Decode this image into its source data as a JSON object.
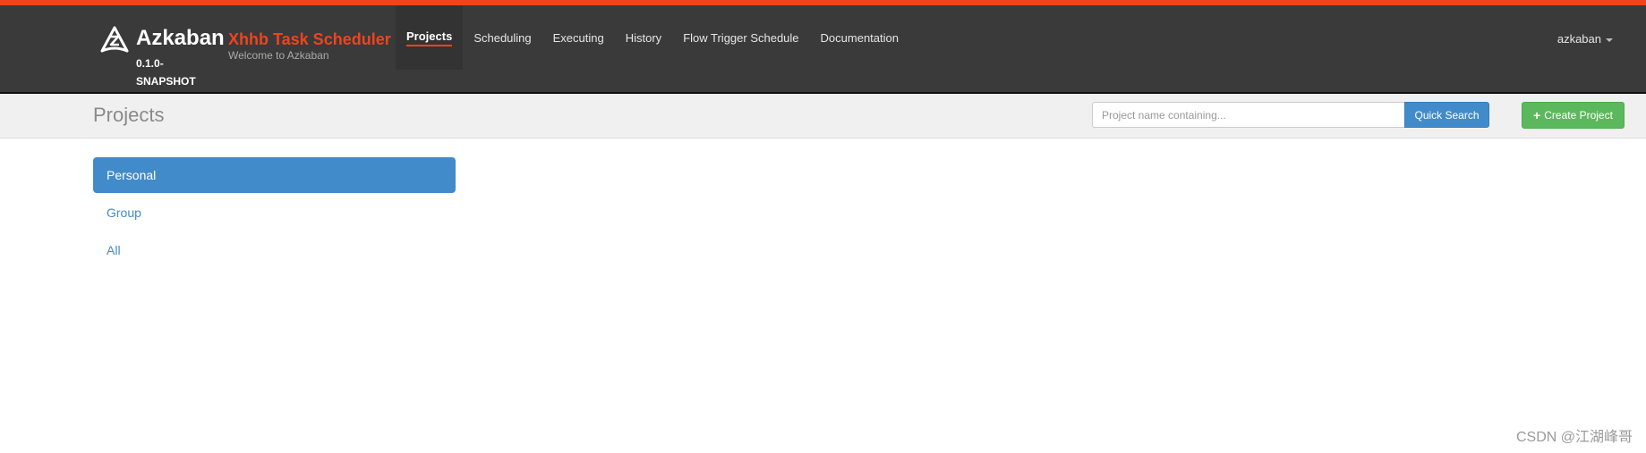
{
  "brand": {
    "name": "Azkaban",
    "version": "0.1.0-SNAPSHOT",
    "scheduler_title": "Xhhb Task Scheduler",
    "welcome": "Welcome to Azkaban"
  },
  "nav": {
    "items": [
      {
        "label": "Projects",
        "active": true
      },
      {
        "label": "Scheduling"
      },
      {
        "label": "Executing"
      },
      {
        "label": "History"
      },
      {
        "label": "Flow Trigger Schedule"
      },
      {
        "label": "Documentation"
      }
    ],
    "user": "azkaban"
  },
  "subheader": {
    "title": "Projects",
    "search_placeholder": "Project name containing...",
    "quick_search_label": "Quick Search",
    "create_project_label": "Create Project"
  },
  "sidebar": {
    "items": [
      {
        "label": "Personal",
        "active": true
      },
      {
        "label": "Group"
      },
      {
        "label": "All"
      }
    ]
  },
  "watermark": "CSDN @江湖峰哥",
  "colors": {
    "accent": "#f0431e",
    "navbar": "#3a3a3a",
    "primary": "#428bca",
    "success": "#5cb85c"
  }
}
